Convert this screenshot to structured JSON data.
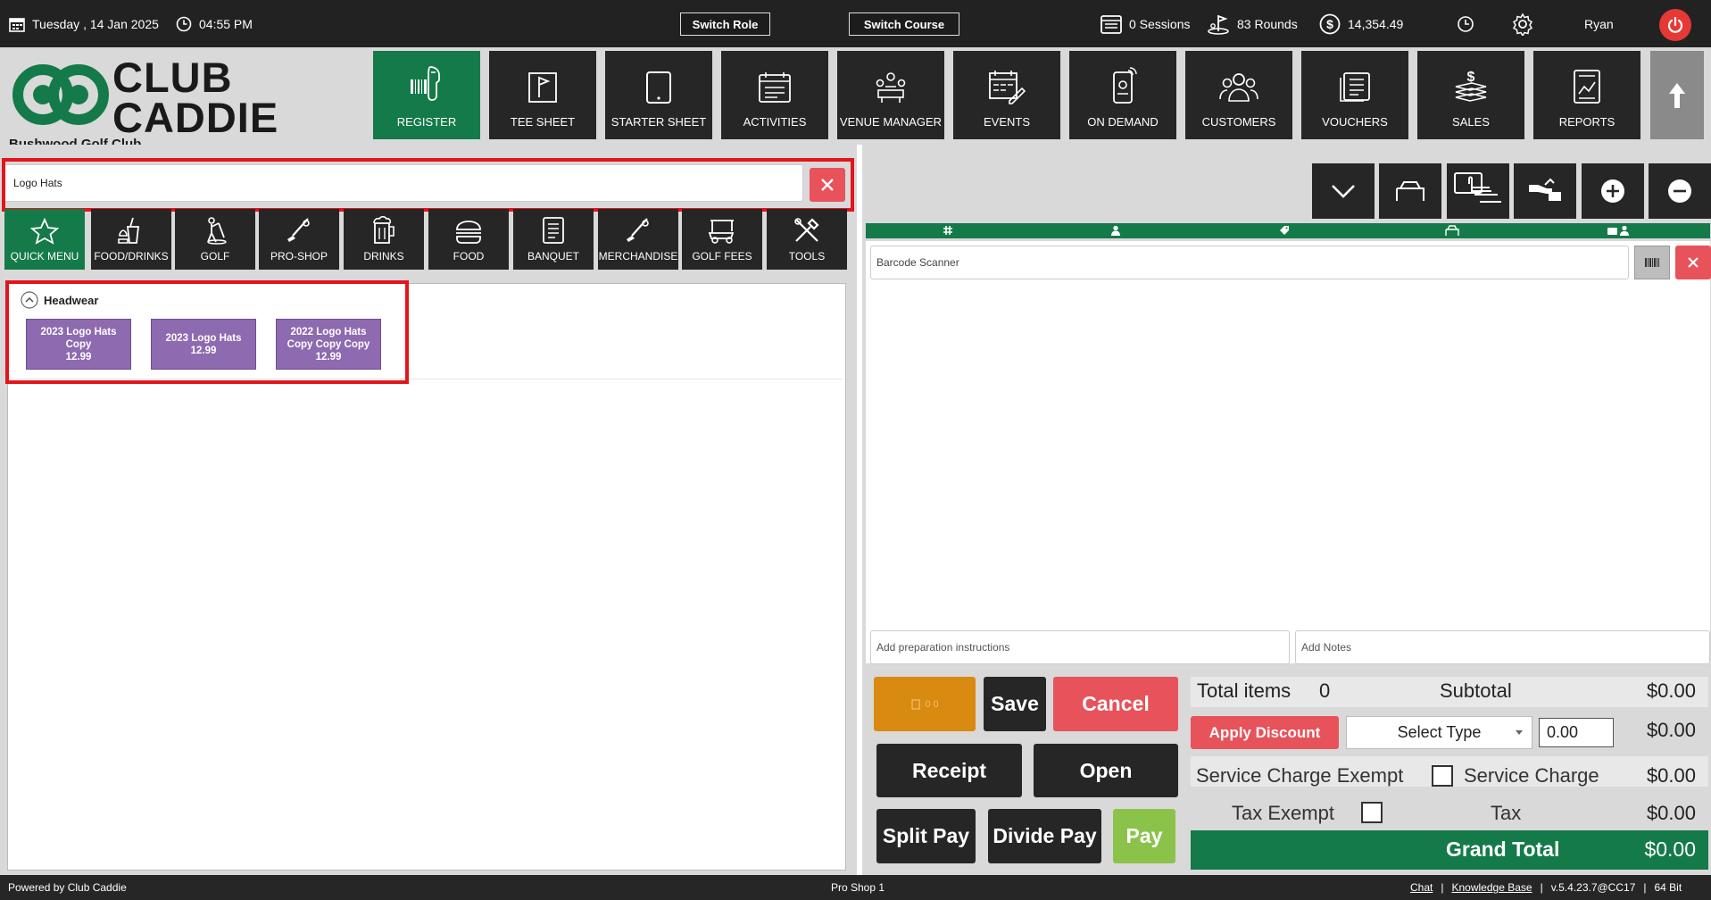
{
  "topbar": {
    "date_label": "Tuesday ,  14 Jan 2025",
    "time_label": "04:55 PM",
    "switch_role_label": "Switch Role",
    "switch_course_label": "Switch Course",
    "sessions_label": "0 Sessions",
    "rounds_label": "83 Rounds",
    "revenue_label": "14,354.49",
    "user_name": "Ryan"
  },
  "brand": {
    "logo_line1": "CLUB",
    "logo_line2": "CADDIE",
    "club_name": "Bushwood Golf Club",
    "logo_color": "#147a49"
  },
  "nav": {
    "items": [
      {
        "label": "REGISTER",
        "icon": "barcode-scanner-icon"
      },
      {
        "label": "TEE SHEET",
        "icon": "flag-icon"
      },
      {
        "label": "STARTER SHEET",
        "icon": "tablet-icon"
      },
      {
        "label": "ACTIVITIES",
        "icon": "calendar-list-icon"
      },
      {
        "label": "VENUE MANAGER",
        "icon": "meeting-icon"
      },
      {
        "label": "EVENTS",
        "icon": "calendar-edit-icon"
      },
      {
        "label": "ON DEMAND",
        "icon": "mobile-icon"
      },
      {
        "label": "CUSTOMERS",
        "icon": "people-icon"
      },
      {
        "label": "VOUCHERS",
        "icon": "voucher-icon"
      },
      {
        "label": "SALES",
        "icon": "money-stack-icon"
      },
      {
        "label": "REPORTS",
        "icon": "report-icon"
      }
    ]
  },
  "search": {
    "value": "Logo Hats"
  },
  "categories": [
    {
      "label": "QUICK MENU",
      "icon": "star-icon"
    },
    {
      "label": "FOOD/DRINKS",
      "icon": "food-drink-icon"
    },
    {
      "label": "GOLF",
      "icon": "golfer-icon"
    },
    {
      "label": "PRO-SHOP",
      "icon": "golf-club-icon"
    },
    {
      "label": "DRINKS",
      "icon": "beer-icon"
    },
    {
      "label": "FOOD",
      "icon": "burger-icon"
    },
    {
      "label": "BANQUET",
      "icon": "menu-icon"
    },
    {
      "label": "MERCHANDISE",
      "icon": "golf-club-icon"
    },
    {
      "label": "GOLF FEES",
      "icon": "golf-cart-icon"
    },
    {
      "label": "TOOLS",
      "icon": "tools-icon"
    }
  ],
  "products": {
    "group_label": "Headwear",
    "items": [
      {
        "line1": "2023 Logo Hats",
        "line2": "Copy",
        "price": "12.99"
      },
      {
        "line1": "2023 Logo Hats",
        "line2": "",
        "price": "12.99"
      },
      {
        "line1": "2022 Logo Hats",
        "line2": "Copy Copy Copy",
        "price": "12.99"
      }
    ],
    "tile_color": "#8e6ab0"
  },
  "cart": {
    "barcode_placeholder": "Barcode Scanner",
    "prep_placeholder": "Add preparation instructions",
    "notes_placeholder": "Add Notes",
    "orange_indicator": "0    0"
  },
  "actions": {
    "save_label": "Save",
    "cancel_label": "Cancel",
    "receipt_label": "Receipt",
    "open_label": "Open",
    "split_pay_label": "Split Pay",
    "divide_pay_label": "Divide Pay",
    "pay_label": "Pay",
    "apply_discount_label": "Apply Discount",
    "discount_type_value": "Select Type",
    "discount_amount_value": "0.00"
  },
  "totals": {
    "total_items_label": "Total items",
    "total_items_value": "0",
    "subtotal_label": "Subtotal",
    "subtotal_value": "$0.00",
    "discount_value": "$0.00",
    "service_charge_exempt_label": "Service Charge Exempt",
    "service_charge_label": "Service Charge",
    "service_charge_value": "$0.00",
    "tax_exempt_label": "Tax Exempt",
    "tax_label": "Tax",
    "tax_value": "$0.00",
    "grand_total_label": "Grand Total",
    "grand_total_value": "$0.00"
  },
  "footer": {
    "powered_by": "Powered by Club Caddie",
    "location": "Pro Shop 1",
    "chat_label": "Chat",
    "kb_label": "Knowledge Base",
    "version": "v.5.4.23.7@CC17",
    "bits": "64 Bit",
    "separator": "|"
  },
  "colors": {
    "accent_green": "#147a49",
    "danger_red": "#e8525a",
    "pay_green": "#8bc34a",
    "orange": "#d98a10",
    "dark_button": "#262626"
  }
}
